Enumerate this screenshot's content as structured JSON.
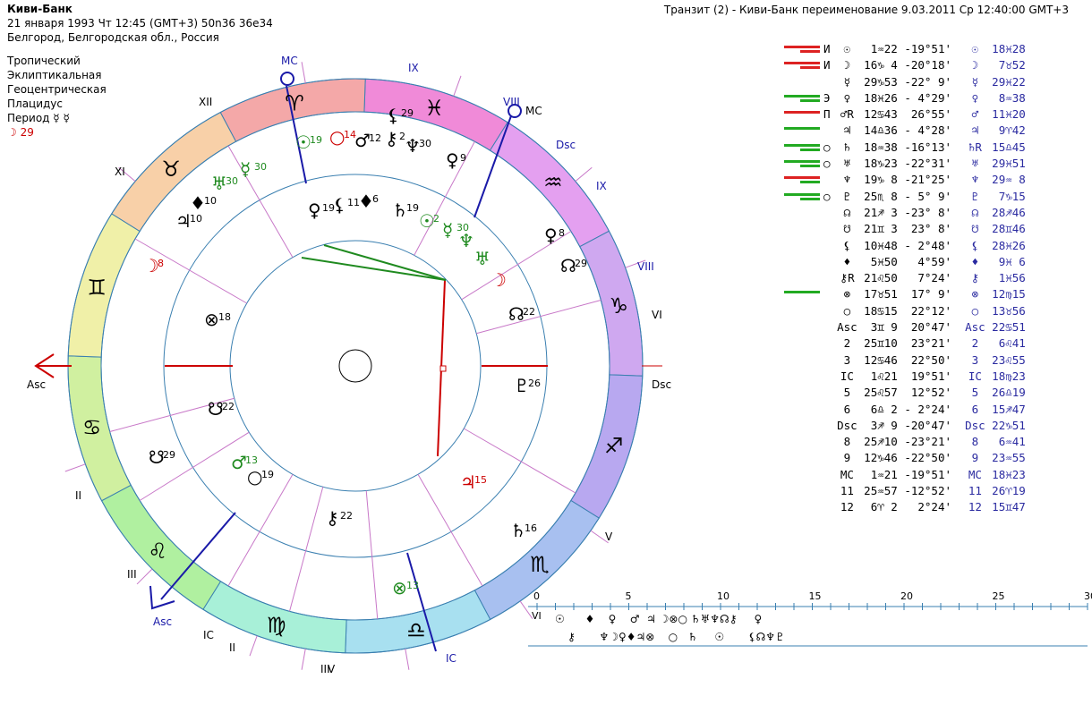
{
  "header": {
    "title": "Киви-Банк",
    "date_line": "21 января 1993  Чт  12:45 (GMT+3) 50n36  36e34",
    "place": "Белгород, Белгородская обл., Россия",
    "transit": "Транзит (2) - Киви-Банк переименование  9.03.2011  Ср 12:40:00 GMT+3"
  },
  "settings": {
    "zodiac": "Тропический",
    "coords": "Эклиптикальная",
    "center": "Геоцентрическая",
    "houses": "Плацидус",
    "period_label": "Период  ☿ ☿",
    "moon_label": "☽  29"
  },
  "wheel": {
    "labels": {
      "asc": "Asc",
      "dsc": "Dsc",
      "mc": "MC",
      "ic": "IC",
      "asc_outer": "Asc",
      "dsc_outer": "Dsc",
      "mc_outer": "MC",
      "ic_outer": "IC"
    },
    "signs": [
      "♓",
      "♒",
      "♑",
      "♐",
      "♏",
      "♎",
      "♍",
      "♌",
      "♋",
      "♊",
      "♉",
      "♈"
    ],
    "house_numbers_outer": [
      "XII",
      "XI",
      "IX",
      "VIII",
      "IX",
      "VIII",
      "VI",
      "V",
      "III",
      "II",
      "II",
      "III",
      "V"
    ],
    "natal_planets": [
      {
        "glyph": "☉",
        "num": "2",
        "color": "green"
      },
      {
        "glyph": "☿",
        "num": "30",
        "color": "green"
      },
      {
        "glyph": "♆",
        "num": "",
        "color": "green"
      },
      {
        "glyph": "♅",
        "num": "",
        "color": "green"
      },
      {
        "glyph": "☽",
        "num": "",
        "color": "red"
      },
      {
        "glyph": "♀",
        "num": "8",
        "color": "black"
      },
      {
        "glyph": "☊",
        "num": "29",
        "color": "black"
      },
      {
        "glyph": "☊",
        "num": "22",
        "color": "black"
      },
      {
        "glyph": "♇",
        "num": "26",
        "color": "black"
      },
      {
        "glyph": "♃",
        "num": "15",
        "color": "red"
      },
      {
        "glyph": "♄",
        "num": "16",
        "color": "black"
      },
      {
        "glyph": "⊗",
        "num": "13",
        "color": "green"
      },
      {
        "glyph": "⚷",
        "num": "22",
        "color": "black"
      },
      {
        "glyph": "♂",
        "num": "13",
        "color": "green"
      },
      {
        "glyph": "○",
        "num": "19",
        "color": "black"
      },
      {
        "glyph": "☋",
        "num": "29",
        "color": "black"
      },
      {
        "glyph": "☋",
        "num": "22",
        "color": "black"
      },
      {
        "glyph": "⊗",
        "num": "18",
        "color": "black"
      },
      {
        "glyph": "♀",
        "num": "19",
        "color": "black"
      },
      {
        "glyph": "⚸",
        "num": "11",
        "color": "black"
      },
      {
        "glyph": "♦",
        "num": "6",
        "color": "black"
      },
      {
        "glyph": "♄",
        "num": "19",
        "color": "black"
      }
    ],
    "transit_planets": [
      {
        "glyph": "☉",
        "num": "19",
        "color": "green"
      },
      {
        "glyph": "○",
        "num": "14",
        "color": "red"
      },
      {
        "glyph": "♂",
        "num": "12",
        "color": "black"
      },
      {
        "glyph": "⚷",
        "num": "2",
        "color": "black"
      },
      {
        "glyph": "♆",
        "num": "30",
        "color": "black"
      },
      {
        "glyph": "♀",
        "num": "9",
        "color": "black"
      },
      {
        "glyph": "⚸",
        "num": "29",
        "color": "black"
      },
      {
        "glyph": "☿",
        "num": "30",
        "color": "green"
      },
      {
        "glyph": "♅",
        "num": "30",
        "color": "green"
      },
      {
        "glyph": "♦",
        "num": "10",
        "color": "black"
      },
      {
        "glyph": "♃",
        "num": "10",
        "color": "black"
      },
      {
        "glyph": "☽",
        "num": "8",
        "color": "red"
      }
    ]
  },
  "table": [
    {
      "bars": "rr",
      "asp": "И",
      "g": "☉",
      "pos": " 1♒22",
      "decl": "-19°51'",
      "tg": "☉",
      "tpos": "18♓28"
    },
    {
      "bars": "rr",
      "asp": "И",
      "g": "☽",
      "pos": "16♑ 4",
      "decl": "-20°18'",
      "tg": "☽",
      "tpos": " 7♉52"
    },
    {
      "bars": "",
      "asp": "",
      "g": "☿",
      "pos": "29♑53",
      "decl": "-22° 9'",
      "tg": "☿",
      "tpos": "29♓22"
    },
    {
      "bars": "gg",
      "asp": "Э",
      "g": "♀",
      "pos": "18♓26",
      "decl": "- 4°29'",
      "tg": "♀",
      "tpos": " 8♒38"
    },
    {
      "bars": "r",
      "asp": "П",
      "g": "♂R",
      "pos": "12♋43",
      "decl": " 26°55'",
      "tg": "♂",
      "tpos": "11♓20"
    },
    {
      "bars": "g",
      "asp": "",
      "g": "♃",
      "pos": "14♎36",
      "decl": "- 4°28'",
      "tg": "♃",
      "tpos": " 9♈42"
    },
    {
      "bars": "gg",
      "asp": "○",
      "g": "♄",
      "pos": "18♒38",
      "decl": "-16°13'",
      "tg": "♄R",
      "tpos": "15♎45"
    },
    {
      "bars": "gg",
      "asp": "○",
      "g": "♅",
      "pos": "18♑23",
      "decl": "-22°31'",
      "tg": "♅",
      "tpos": "29♓51"
    },
    {
      "bars": "rg",
      "asp": "",
      "g": "♆",
      "pos": "19♑ 8",
      "decl": "-21°25'",
      "tg": "♆",
      "tpos": "29♒ 8"
    },
    {
      "bars": "gg",
      "asp": "○",
      "g": "♇",
      "pos": "25♏ 8",
      "decl": "- 5° 9'",
      "tg": "♇",
      "tpos": " 7♑15"
    },
    {
      "bars": "",
      "asp": "",
      "g": "☊",
      "pos": "21♐ 3",
      "decl": "-23° 8'",
      "tg": "☊",
      "tpos": "28♐46"
    },
    {
      "bars": "",
      "asp": "",
      "g": "☋",
      "pos": "21♊ 3",
      "decl": " 23° 8'",
      "tg": "☋",
      "tpos": "28♊46"
    },
    {
      "bars": "",
      "asp": "",
      "g": "⚸",
      "pos": "10♓48",
      "decl": "- 2°48'",
      "tg": "⚸",
      "tpos": "28♓26"
    },
    {
      "bars": "",
      "asp": "",
      "g": "♦",
      "pos": " 5♓50",
      "decl": "  4°59'",
      "tg": "♦",
      "tpos": " 9♓ 6"
    },
    {
      "bars": "",
      "asp": "",
      "g": "⚷R",
      "pos": "21♌50",
      "decl": "  7°24'",
      "tg": "⚷",
      "tpos": " 1♓56"
    },
    {
      "bars": "g",
      "asp": "",
      "g": "⊗",
      "pos": "17♉51",
      "decl": " 17° 9'",
      "tg": "⊗",
      "tpos": "12♍15"
    },
    {
      "bars": "",
      "asp": "",
      "g": "○",
      "pos": "18♋15",
      "decl": " 22°12'",
      "tg": "○",
      "tpos": "13♉56"
    },
    {
      "bars": "",
      "asp": "",
      "g": "Asc",
      "pos": " 3♊ 9",
      "decl": " 20°47'",
      "tg": "Asc",
      "tpos": "22♋51"
    },
    {
      "bars": "",
      "asp": "",
      "g": "2",
      "pos": "25♊10",
      "decl": " 23°21'",
      "tg": "2",
      "tpos": " 6♌41"
    },
    {
      "bars": "",
      "asp": "",
      "g": "3",
      "pos": "12♋46",
      "decl": " 22°50'",
      "tg": "3",
      "tpos": "23♌55"
    },
    {
      "bars": "",
      "asp": "",
      "g": "IC",
      "pos": " 1♌21",
      "decl": " 19°51'",
      "tg": "IC",
      "tpos": "18♍23"
    },
    {
      "bars": "",
      "asp": "",
      "g": "5",
      "pos": "25♌57",
      "decl": " 12°52'",
      "tg": "5",
      "tpos": "26♎19"
    },
    {
      "bars": "",
      "asp": "",
      "g": "6",
      "pos": " 6♎ 2",
      "decl": "- 2°24'",
      "tg": "6",
      "tpos": "15♐47"
    },
    {
      "bars": "",
      "asp": "",
      "g": "Dsc",
      "pos": " 3♐ 9",
      "decl": "-20°47'",
      "tg": "Dsc",
      "tpos": "22♑51"
    },
    {
      "bars": "",
      "asp": "",
      "g": "8",
      "pos": "25♐10",
      "decl": "-23°21'",
      "tg": "8",
      "tpos": " 6♒41"
    },
    {
      "bars": "",
      "asp": "",
      "g": "9",
      "pos": "12♑46",
      "decl": "-22°50'",
      "tg": "9",
      "tpos": "23♒55"
    },
    {
      "bars": "",
      "asp": "",
      "g": "MC",
      "pos": " 1♒21",
      "decl": "-19°51'",
      "tg": "MC",
      "tpos": "18♓23"
    },
    {
      "bars": "",
      "asp": "",
      "g": "11",
      "pos": "25♒57",
      "decl": "-12°52'",
      "tg": "11",
      "tpos": "26♈19"
    },
    {
      "bars": "",
      "asp": "",
      "g": "12",
      "pos": " 6♈ 2",
      "decl": "  2°24'",
      "tg": "12",
      "tpos": "15♊47"
    }
  ],
  "timeline": {
    "ticks": [
      "0",
      "5",
      "10",
      "15",
      "20",
      "25",
      "30"
    ],
    "house_label": "VI",
    "top_glyphs": "☉      ♦    ♀    ♂  ♃ ☽⊗○ ♄♅♆☊⚷     ♀",
    "bottom_glyphs": "⚷       ♆☽♀♦♃⊗    ○   ♄     ☉       ⚸☊♆♇"
  }
}
